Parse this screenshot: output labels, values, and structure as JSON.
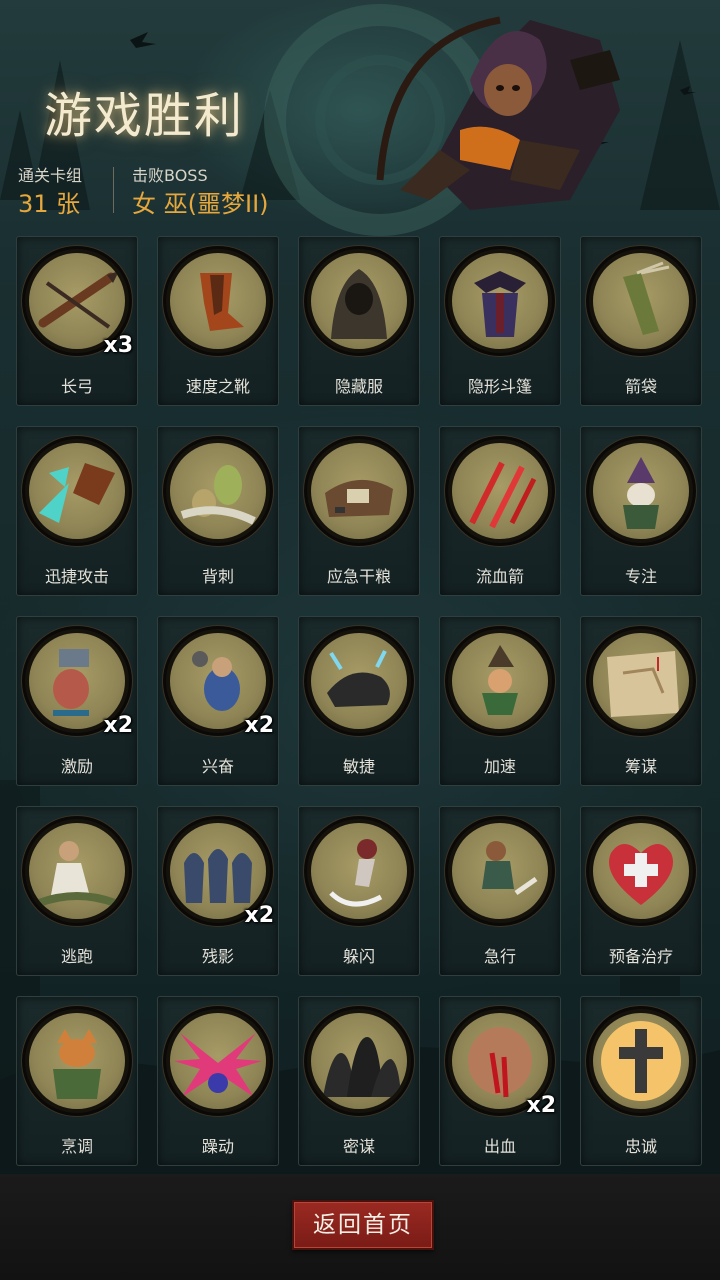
{
  "header": {
    "title": "游戏胜利",
    "deck_label": "通关卡组",
    "deck_value": "31 张",
    "boss_label": "击败BOSS",
    "boss_value": "女 巫(噩梦II)"
  },
  "cards": [
    {
      "label": "长弓",
      "count": "x3",
      "icon": "longbow-icon"
    },
    {
      "label": "速度之靴",
      "count": "",
      "icon": "speed-boots-icon"
    },
    {
      "label": "隐藏服",
      "count": "",
      "icon": "hooded-cloak-icon"
    },
    {
      "label": "隐形斗篷",
      "count": "",
      "icon": "invisibility-cape-icon"
    },
    {
      "label": "箭袋",
      "count": "",
      "icon": "quiver-icon"
    },
    {
      "label": "迅捷攻击",
      "count": "",
      "icon": "swift-attack-icon"
    },
    {
      "label": "背刺",
      "count": "",
      "icon": "backstab-icon"
    },
    {
      "label": "应急干粮",
      "count": "",
      "icon": "rations-icon"
    },
    {
      "label": "流血箭",
      "count": "",
      "icon": "bleeding-arrow-icon"
    },
    {
      "label": "专注",
      "count": "",
      "icon": "focus-wizard-icon"
    },
    {
      "label": "激励",
      "count": "x2",
      "icon": "inspire-icon"
    },
    {
      "label": "兴奋",
      "count": "x2",
      "icon": "excited-icon"
    },
    {
      "label": "敏捷",
      "count": "",
      "icon": "agile-panther-icon"
    },
    {
      "label": "加速",
      "count": "",
      "icon": "haste-witch-icon"
    },
    {
      "label": "筹谋",
      "count": "",
      "icon": "plan-map-icon"
    },
    {
      "label": "逃跑",
      "count": "",
      "icon": "escape-icon"
    },
    {
      "label": "残影",
      "count": "x2",
      "icon": "afterimage-icon"
    },
    {
      "label": "躲闪",
      "count": "",
      "icon": "dodge-icon"
    },
    {
      "label": "急行",
      "count": "",
      "icon": "dash-icon"
    },
    {
      "label": "预备治疗",
      "count": "",
      "icon": "heal-heart-icon"
    },
    {
      "label": "烹调",
      "count": "",
      "icon": "cooking-fox-icon"
    },
    {
      "label": "躁动",
      "count": "",
      "icon": "frenzy-icon"
    },
    {
      "label": "密谋",
      "count": "",
      "icon": "conspiracy-icon"
    },
    {
      "label": "出血",
      "count": "x2",
      "icon": "bleed-icon"
    },
    {
      "label": "忠诚",
      "count": "",
      "icon": "loyalty-cross-icon"
    }
  ],
  "footer": {
    "back_label": "返回首页"
  },
  "colors": {
    "accent": "#e6a83c",
    "button": "#8c241d",
    "medal": "#9a9060"
  }
}
